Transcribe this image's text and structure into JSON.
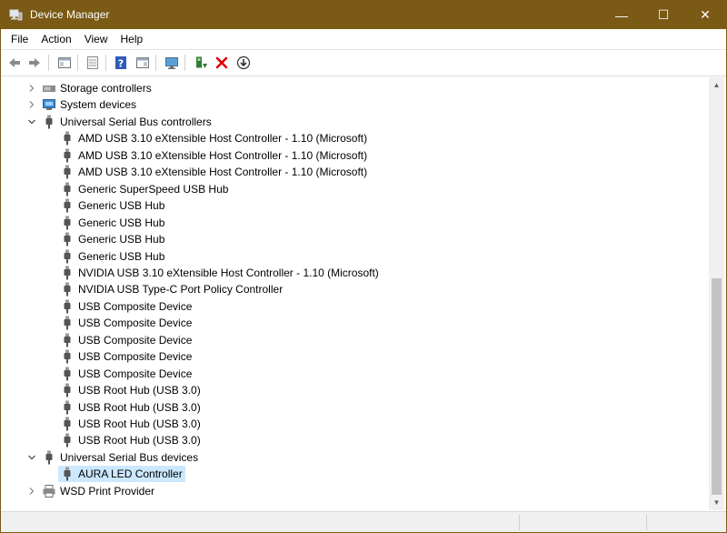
{
  "window": {
    "title": "Device Manager",
    "controls": {
      "minimize": "—",
      "maximize": "☐",
      "close": "✕"
    },
    "accent": "#7a5a14"
  },
  "menu": [
    "File",
    "Action",
    "View",
    "Help"
  ],
  "toolbar": {
    "buttons": [
      "back-icon",
      "forward-icon",
      "properties-view-icon",
      "show-hidden-icon",
      "help-icon",
      "action-icon",
      "monitor-icon",
      "update-driver-icon",
      "uninstall-icon",
      "download-icon"
    ]
  },
  "tree": [
    {
      "label": "Storage controllers",
      "level": 0,
      "expander": "collapsed",
      "icon": "storage-controller-icon"
    },
    {
      "label": "System devices",
      "level": 0,
      "expander": "collapsed",
      "icon": "system-device-icon"
    },
    {
      "label": "Universal Serial Bus controllers",
      "level": 0,
      "expander": "expanded",
      "icon": "usb-icon"
    },
    {
      "label": "AMD USB 3.10 eXtensible Host Controller - 1.10 (Microsoft)",
      "level": 1,
      "icon": "usb-icon"
    },
    {
      "label": "AMD USB 3.10 eXtensible Host Controller - 1.10 (Microsoft)",
      "level": 1,
      "icon": "usb-icon"
    },
    {
      "label": "AMD USB 3.10 eXtensible Host Controller - 1.10 (Microsoft)",
      "level": 1,
      "icon": "usb-icon"
    },
    {
      "label": "Generic SuperSpeed USB Hub",
      "level": 1,
      "icon": "usb-icon"
    },
    {
      "label": "Generic USB Hub",
      "level": 1,
      "icon": "usb-icon"
    },
    {
      "label": "Generic USB Hub",
      "level": 1,
      "icon": "usb-icon"
    },
    {
      "label": "Generic USB Hub",
      "level": 1,
      "icon": "usb-icon"
    },
    {
      "label": "Generic USB Hub",
      "level": 1,
      "icon": "usb-icon"
    },
    {
      "label": "NVIDIA USB 3.10 eXtensible Host Controller - 1.10 (Microsoft)",
      "level": 1,
      "icon": "usb-icon"
    },
    {
      "label": "NVIDIA USB Type-C Port Policy Controller",
      "level": 1,
      "icon": "usb-icon"
    },
    {
      "label": "USB Composite Device",
      "level": 1,
      "icon": "usb-icon"
    },
    {
      "label": "USB Composite Device",
      "level": 1,
      "icon": "usb-icon"
    },
    {
      "label": "USB Composite Device",
      "level": 1,
      "icon": "usb-icon"
    },
    {
      "label": "USB Composite Device",
      "level": 1,
      "icon": "usb-icon"
    },
    {
      "label": "USB Composite Device",
      "level": 1,
      "icon": "usb-icon"
    },
    {
      "label": "USB Root Hub (USB 3.0)",
      "level": 1,
      "icon": "usb-icon"
    },
    {
      "label": "USB Root Hub (USB 3.0)",
      "level": 1,
      "icon": "usb-icon"
    },
    {
      "label": "USB Root Hub (USB 3.0)",
      "level": 1,
      "icon": "usb-icon"
    },
    {
      "label": "USB Root Hub (USB 3.0)",
      "level": 1,
      "icon": "usb-icon"
    },
    {
      "label": "Universal Serial Bus devices",
      "level": 0,
      "expander": "expanded",
      "icon": "usb-icon"
    },
    {
      "label": "AURA LED Controller",
      "level": 1,
      "icon": "usb-icon",
      "selected": true
    },
    {
      "label": "WSD Print Provider",
      "level": 0,
      "expander": "collapsed",
      "icon": "print-provider-icon"
    }
  ],
  "colors": {
    "selection": "#cce8ff"
  }
}
